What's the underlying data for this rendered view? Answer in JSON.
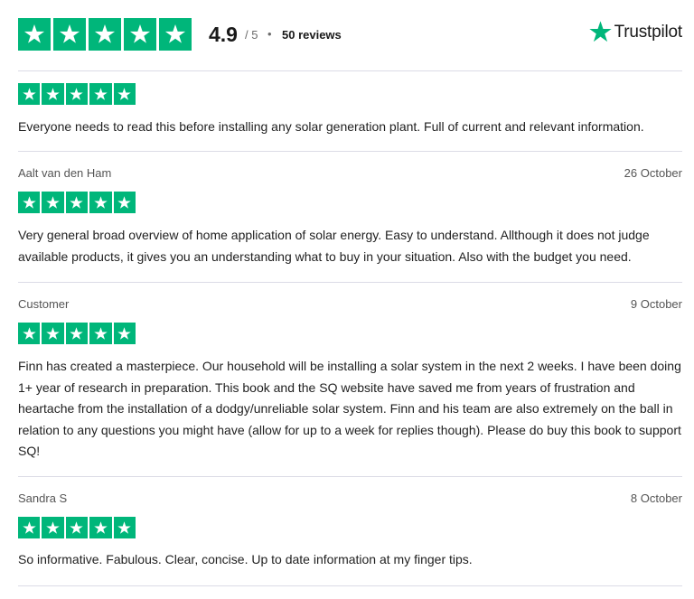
{
  "summary": {
    "score": "4.9",
    "scale": "/ 5",
    "separator": "•",
    "reviews_count": "50 reviews",
    "star_rating": 5,
    "brand": "Trustpilot"
  },
  "colors": {
    "star_green": "#00b67a",
    "divider": "#dcdce6"
  },
  "icons": {
    "star": "star-icon",
    "brand": "trustpilot-star-icon"
  },
  "reviews": [
    {
      "author": "",
      "date": "",
      "stars": 5,
      "text": "Everyone needs to read this before installing any solar generation plant. Full of current and relevant information."
    },
    {
      "author": "Aalt van den Ham",
      "date": "26 October",
      "stars": 5,
      "text": "Very general broad overview of home application of solar energy. Easy to understand. Allthough it does not judge available products, it gives you an understanding what to buy in your situation. Also with the budget you need."
    },
    {
      "author": "Customer",
      "date": "9 October",
      "stars": 5,
      "text": "Finn has created a masterpiece. Our household will be installing a solar system in the next 2 weeks. I have been doing 1+ year of research in preparation. This book and the SQ website have saved me from years of frustration and heartache from the installation of a dodgy/unreliable solar system. Finn and his team are also extremely on the ball in relation to any questions you might have (allow for up to a week for replies though). Please do buy this book to support SQ!"
    },
    {
      "author": "Sandra S",
      "date": "8 October",
      "stars": 5,
      "text": "So informative. Fabulous. Clear, concise. Up to date information at my finger tips."
    }
  ]
}
